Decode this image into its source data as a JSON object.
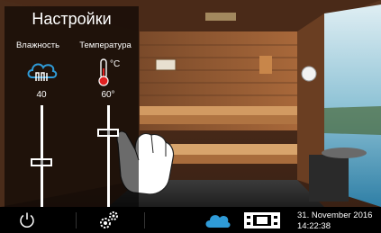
{
  "panel": {
    "title": "Настройки",
    "humidity": {
      "label": "Влажность",
      "value": "40",
      "level": 0.45
    },
    "temperature": {
      "label": "Температура",
      "value": "60°",
      "unit": "°C",
      "level": 0.72
    }
  },
  "bottom_bar": {
    "date": "31. November 2016",
    "time": "14:22:38",
    "icons": [
      "power-icon",
      "gears-icon",
      "cloud-icon",
      "sauna-mode-icon"
    ]
  },
  "colors": {
    "accent_blue": "#2f9bd8",
    "thermometer_red": "#e02020",
    "bar_background": "#000000"
  }
}
